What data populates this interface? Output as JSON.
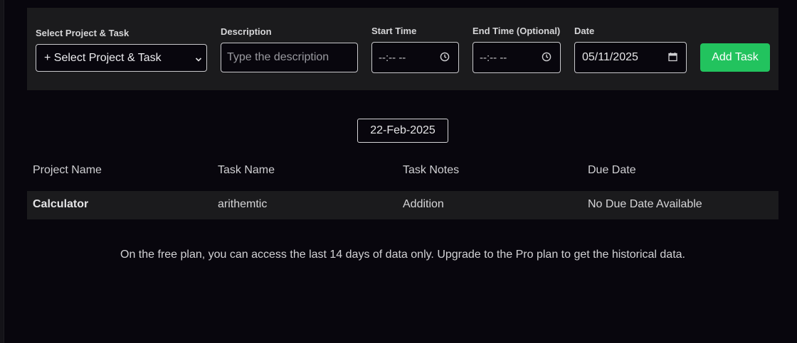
{
  "form": {
    "project_label": "Select Project & Task",
    "project_value": "+ Select Project & Task",
    "description_label": "Description",
    "description_placeholder": "Type the description",
    "start_label": "Start Time",
    "start_value": "--:-- --",
    "end_label": "End Time (Optional)",
    "end_value": "--:-- --",
    "date_label": "Date",
    "date_value": "05/11/2025",
    "add_button": "Add Task"
  },
  "date_badge": "22-Feb-2025",
  "table": {
    "headers": [
      "Project Name",
      "Task Name",
      "Task Notes",
      "Due Date"
    ],
    "rows": [
      [
        "Calculator",
        "arithemtic",
        "Addition",
        "No Due Date Available"
      ]
    ]
  },
  "notice": "On the free plan, you can access the last 14 days of data only. Upgrade to the Pro plan to get the historical data.",
  "icons": {
    "dropdown": "chevron-down-icon",
    "time": "clock-icon",
    "date": "calendar-icon"
  },
  "colors": {
    "background": "#08060d",
    "panel": "#1b1b1d",
    "accent": "#22c35e"
  }
}
